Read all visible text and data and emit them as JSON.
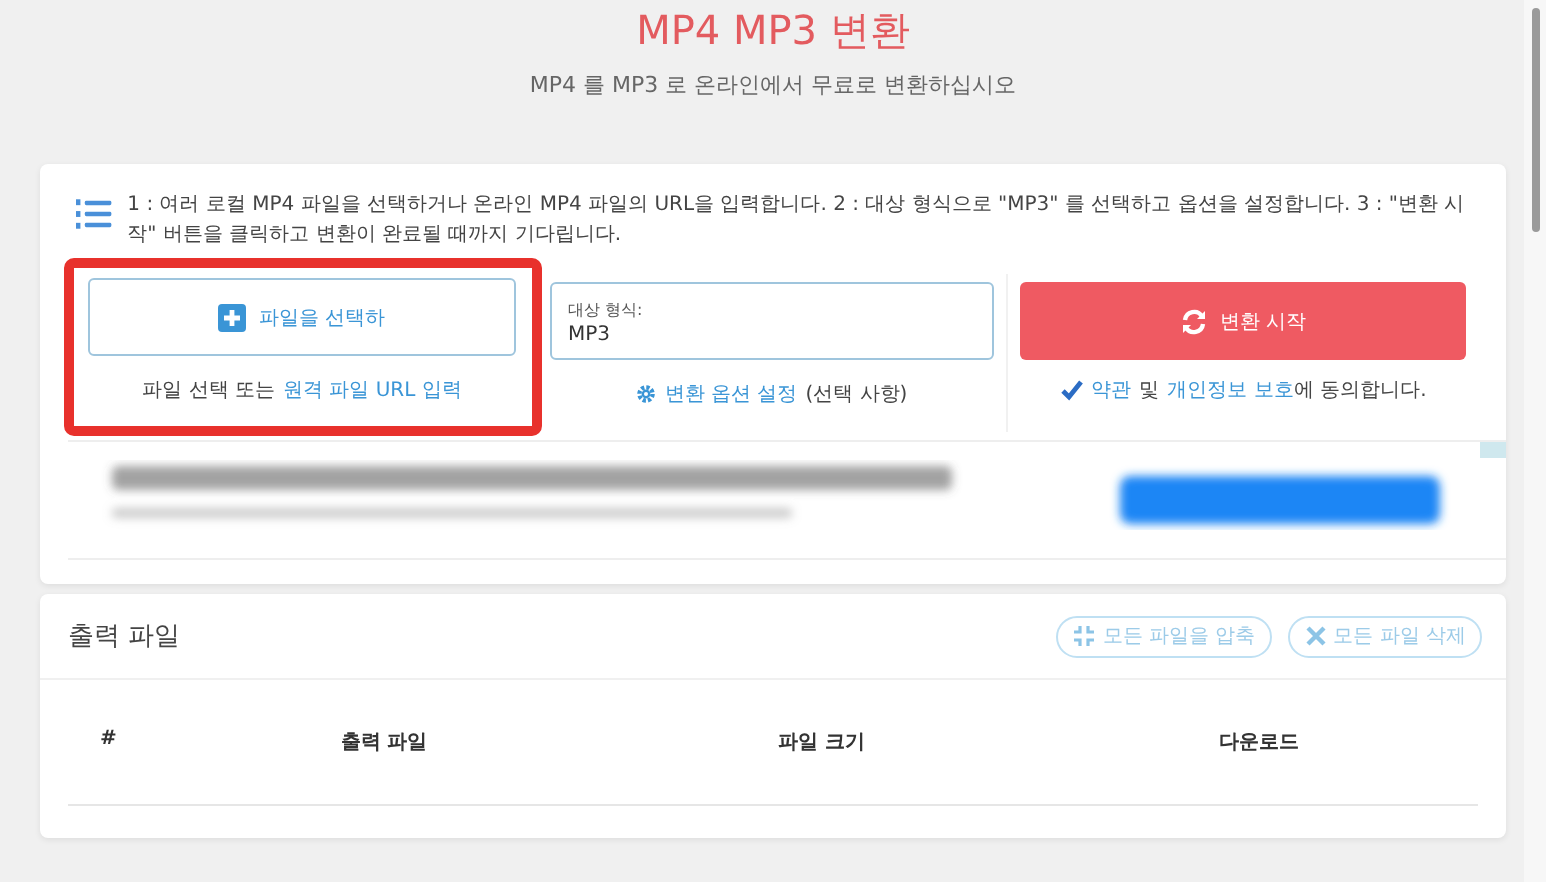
{
  "header": {
    "title": "MP4 MP3 변환",
    "subtitle": "MP4 를 MP3 로 온라인에서 무료로 변환하십시오"
  },
  "steps": {
    "text": "1 : 여러 로컬 MP4 파일을 선택하거나 온라인 MP4 파일의 URL을 입력합니다. 2 : 대상 형식으로 \"MP3\" 를 선택하고 옵션을 설정합니다. 3 : \"변환 시작\" 버튼을 클릭하고 변환이 완료될 때까지 기다립니다."
  },
  "file_select": {
    "highlighted": true,
    "button": "파일을 선택하",
    "note": "파일 선택 또는",
    "link": "원격 파일 URL 입력"
  },
  "target_format": {
    "label": "대상 형식:",
    "value": "MP3",
    "options_link": "변환 옵션 설정",
    "options_note": "(선택 사항)"
  },
  "start": {
    "button": "변환 시작",
    "agree_checked": true,
    "terms_link": "약관",
    "and": "및",
    "privacy_link": "개인정보 보호",
    "agree_suffix": "에 동의합니다."
  },
  "output": {
    "title": "출력 파일",
    "buttons": [
      {
        "label": "모든 파일을 압축",
        "kind": "zip",
        "disabled": true
      },
      {
        "label": "모든 파일 삭제",
        "kind": "delete",
        "disabled": true
      }
    ],
    "columns": [
      "#",
      "출력 파일",
      "파일 크기",
      "다운로드"
    ]
  }
}
